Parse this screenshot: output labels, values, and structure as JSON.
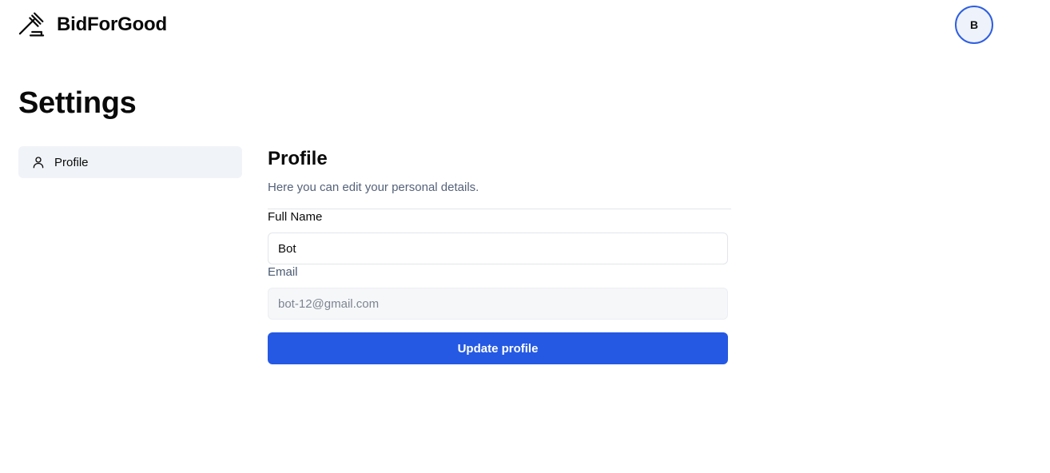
{
  "header": {
    "brand_name": "BidForGood",
    "brand_icon": "gavel-icon",
    "avatar_initial": "B",
    "avatar_border_color": "#2f5fe0"
  },
  "page": {
    "title": "Settings"
  },
  "sidebar": {
    "items": [
      {
        "label": "Profile",
        "icon": "user-icon",
        "active": true
      }
    ]
  },
  "profile": {
    "title": "Profile",
    "description": "Here you can edit your personal details.",
    "full_name_label": "Full Name",
    "full_name_value": "Bot",
    "email_label": "Email",
    "email_value": "bot-12@gmail.com",
    "update_button_label": "Update profile",
    "button_color": "#2559e3"
  }
}
